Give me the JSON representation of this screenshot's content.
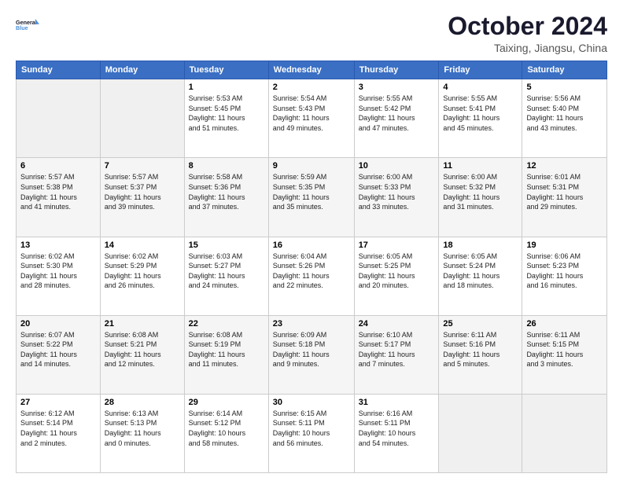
{
  "header": {
    "logo_line1": "General",
    "logo_line2": "Blue",
    "month": "October 2024",
    "location": "Taixing, Jiangsu, China"
  },
  "weekdays": [
    "Sunday",
    "Monday",
    "Tuesday",
    "Wednesday",
    "Thursday",
    "Friday",
    "Saturday"
  ],
  "weeks": [
    [
      {
        "day": "",
        "info": ""
      },
      {
        "day": "",
        "info": ""
      },
      {
        "day": "1",
        "info": "Sunrise: 5:53 AM\nSunset: 5:45 PM\nDaylight: 11 hours\nand 51 minutes."
      },
      {
        "day": "2",
        "info": "Sunrise: 5:54 AM\nSunset: 5:43 PM\nDaylight: 11 hours\nand 49 minutes."
      },
      {
        "day": "3",
        "info": "Sunrise: 5:55 AM\nSunset: 5:42 PM\nDaylight: 11 hours\nand 47 minutes."
      },
      {
        "day": "4",
        "info": "Sunrise: 5:55 AM\nSunset: 5:41 PM\nDaylight: 11 hours\nand 45 minutes."
      },
      {
        "day": "5",
        "info": "Sunrise: 5:56 AM\nSunset: 5:40 PM\nDaylight: 11 hours\nand 43 minutes."
      }
    ],
    [
      {
        "day": "6",
        "info": "Sunrise: 5:57 AM\nSunset: 5:38 PM\nDaylight: 11 hours\nand 41 minutes."
      },
      {
        "day": "7",
        "info": "Sunrise: 5:57 AM\nSunset: 5:37 PM\nDaylight: 11 hours\nand 39 minutes."
      },
      {
        "day": "8",
        "info": "Sunrise: 5:58 AM\nSunset: 5:36 PM\nDaylight: 11 hours\nand 37 minutes."
      },
      {
        "day": "9",
        "info": "Sunrise: 5:59 AM\nSunset: 5:35 PM\nDaylight: 11 hours\nand 35 minutes."
      },
      {
        "day": "10",
        "info": "Sunrise: 6:00 AM\nSunset: 5:33 PM\nDaylight: 11 hours\nand 33 minutes."
      },
      {
        "day": "11",
        "info": "Sunrise: 6:00 AM\nSunset: 5:32 PM\nDaylight: 11 hours\nand 31 minutes."
      },
      {
        "day": "12",
        "info": "Sunrise: 6:01 AM\nSunset: 5:31 PM\nDaylight: 11 hours\nand 29 minutes."
      }
    ],
    [
      {
        "day": "13",
        "info": "Sunrise: 6:02 AM\nSunset: 5:30 PM\nDaylight: 11 hours\nand 28 minutes."
      },
      {
        "day": "14",
        "info": "Sunrise: 6:02 AM\nSunset: 5:29 PM\nDaylight: 11 hours\nand 26 minutes."
      },
      {
        "day": "15",
        "info": "Sunrise: 6:03 AM\nSunset: 5:27 PM\nDaylight: 11 hours\nand 24 minutes."
      },
      {
        "day": "16",
        "info": "Sunrise: 6:04 AM\nSunset: 5:26 PM\nDaylight: 11 hours\nand 22 minutes."
      },
      {
        "day": "17",
        "info": "Sunrise: 6:05 AM\nSunset: 5:25 PM\nDaylight: 11 hours\nand 20 minutes."
      },
      {
        "day": "18",
        "info": "Sunrise: 6:05 AM\nSunset: 5:24 PM\nDaylight: 11 hours\nand 18 minutes."
      },
      {
        "day": "19",
        "info": "Sunrise: 6:06 AM\nSunset: 5:23 PM\nDaylight: 11 hours\nand 16 minutes."
      }
    ],
    [
      {
        "day": "20",
        "info": "Sunrise: 6:07 AM\nSunset: 5:22 PM\nDaylight: 11 hours\nand 14 minutes."
      },
      {
        "day": "21",
        "info": "Sunrise: 6:08 AM\nSunset: 5:21 PM\nDaylight: 11 hours\nand 12 minutes."
      },
      {
        "day": "22",
        "info": "Sunrise: 6:08 AM\nSunset: 5:19 PM\nDaylight: 11 hours\nand 11 minutes."
      },
      {
        "day": "23",
        "info": "Sunrise: 6:09 AM\nSunset: 5:18 PM\nDaylight: 11 hours\nand 9 minutes."
      },
      {
        "day": "24",
        "info": "Sunrise: 6:10 AM\nSunset: 5:17 PM\nDaylight: 11 hours\nand 7 minutes."
      },
      {
        "day": "25",
        "info": "Sunrise: 6:11 AM\nSunset: 5:16 PM\nDaylight: 11 hours\nand 5 minutes."
      },
      {
        "day": "26",
        "info": "Sunrise: 6:11 AM\nSunset: 5:15 PM\nDaylight: 11 hours\nand 3 minutes."
      }
    ],
    [
      {
        "day": "27",
        "info": "Sunrise: 6:12 AM\nSunset: 5:14 PM\nDaylight: 11 hours\nand 2 minutes."
      },
      {
        "day": "28",
        "info": "Sunrise: 6:13 AM\nSunset: 5:13 PM\nDaylight: 11 hours\nand 0 minutes."
      },
      {
        "day": "29",
        "info": "Sunrise: 6:14 AM\nSunset: 5:12 PM\nDaylight: 10 hours\nand 58 minutes."
      },
      {
        "day": "30",
        "info": "Sunrise: 6:15 AM\nSunset: 5:11 PM\nDaylight: 10 hours\nand 56 minutes."
      },
      {
        "day": "31",
        "info": "Sunrise: 6:16 AM\nSunset: 5:11 PM\nDaylight: 10 hours\nand 54 minutes."
      },
      {
        "day": "",
        "info": ""
      },
      {
        "day": "",
        "info": ""
      }
    ]
  ]
}
